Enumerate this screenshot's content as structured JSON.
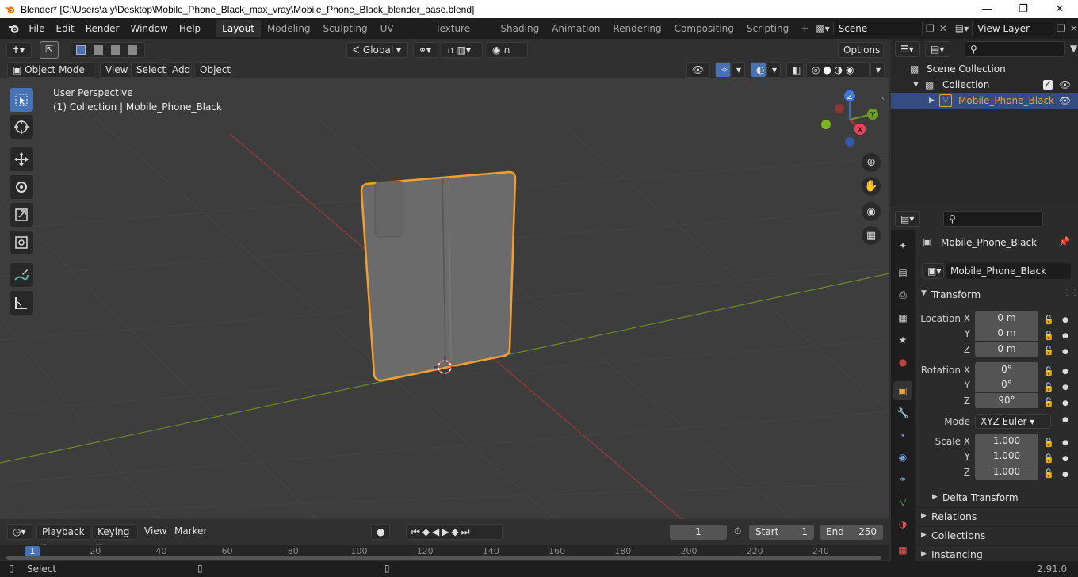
{
  "window": {
    "title": "Blender* [C:\\Users\\a y\\Desktop\\Mobile_Phone_Black_max_vray\\Mobile_Phone_Black_blender_base.blend]"
  },
  "menu": [
    "File",
    "Edit",
    "Render",
    "Window",
    "Help"
  ],
  "workspaces": [
    "Layout",
    "Modeling",
    "Sculpting",
    "UV Editing",
    "Texture Paint",
    "Shading",
    "Animation",
    "Rendering",
    "Compositing",
    "Scripting"
  ],
  "scene": {
    "name": "Scene",
    "view_layer": "View Layer"
  },
  "viewport_header": {
    "transform_orientation": "Global",
    "options": "Options",
    "mode": "Object Mode",
    "menus": [
      "View",
      "Select",
      "Add",
      "Object"
    ]
  },
  "viewport": {
    "perspective": "User Perspective",
    "collection_info": "(1) Collection | Mobile_Phone_Black",
    "gizmo": {
      "x": "X",
      "y": "Y",
      "z": "Z"
    }
  },
  "outliner": {
    "root": "Scene Collection",
    "collection": "Collection",
    "object": "Mobile_Phone_Black"
  },
  "properties": {
    "object_name": "Mobile_Phone_Black",
    "data_name": "Mobile_Phone_Black",
    "transform_label": "Transform",
    "location": {
      "label_x": "Location X",
      "label_y": "Y",
      "label_z": "Z",
      "x": "0 m",
      "y": "0 m",
      "z": "0 m"
    },
    "rotation": {
      "label_x": "Rotation X",
      "label_y": "Y",
      "label_z": "Z",
      "x": "0°",
      "y": "0°",
      "z": "90°"
    },
    "mode_label": "Mode",
    "mode_value": "XYZ Euler",
    "scale": {
      "label_x": "Scale X",
      "label_y": "Y",
      "label_z": "Z",
      "x": "1.000",
      "y": "1.000",
      "z": "1.000"
    },
    "delta_transform": "Delta Transform",
    "relations": "Relations",
    "collections": "Collections",
    "instancing": "Instancing"
  },
  "timeline": {
    "menus": [
      "Playback",
      "Keying",
      "View",
      "Marker"
    ],
    "current_frame": "1",
    "start_label": "Start",
    "start": "1",
    "end_label": "End",
    "end": "250",
    "ruler": [
      "1",
      "20",
      "40",
      "60",
      "80",
      "100",
      "120",
      "140",
      "160",
      "180",
      "200",
      "220",
      "240"
    ]
  },
  "status": {
    "left": "Select",
    "version": "2.91.0"
  },
  "colors": {
    "accent": "#4772b3",
    "selection": "#f0a030",
    "x_axis": "#9a3a3a",
    "y_axis": "#6a8a2a"
  }
}
